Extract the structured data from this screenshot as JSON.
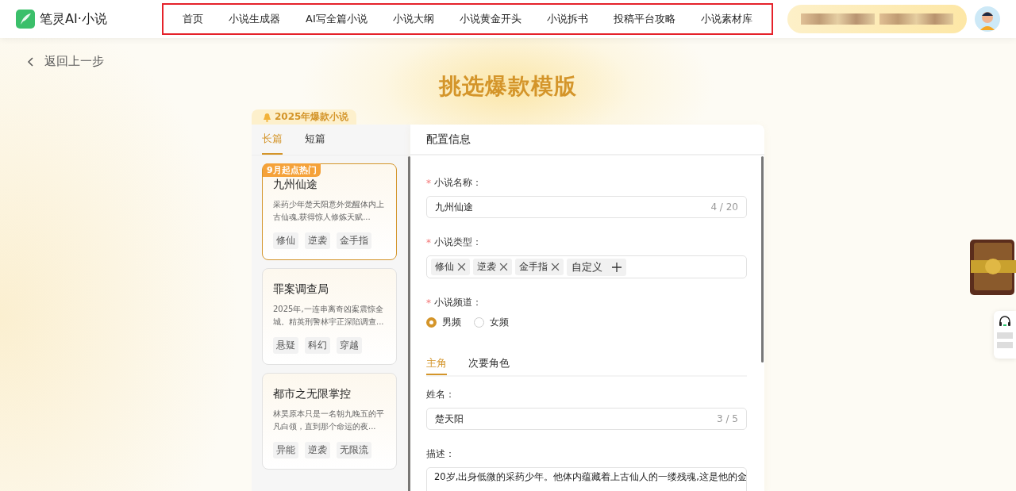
{
  "header": {
    "logo_text": "笔灵AI·小说",
    "nav": [
      {
        "label": "首页"
      },
      {
        "label": "小说生成器"
      },
      {
        "label": "AI写全篇小说"
      },
      {
        "label": "小说大纲"
      },
      {
        "label": "小说黄金开头"
      },
      {
        "label": "小说拆书"
      },
      {
        "label": "投稿平台攻略"
      },
      {
        "label": "小说素材库"
      }
    ]
  },
  "back_link": "返回上一步",
  "page_title": "挑选爆款模版",
  "section_badge": "2025年爆款小说",
  "length_tabs": [
    {
      "label": "长篇",
      "selected": true
    },
    {
      "label": "短篇",
      "selected": false
    }
  ],
  "templates": [
    {
      "title": "九州仙途",
      "summary": "采药少年楚天阳意外觉醒体内上古仙魂,获得惊人修炼天赋...",
      "tags": [
        "修仙",
        "逆袭",
        "金手指"
      ],
      "selected": true,
      "ribbon": "9月起点热门"
    },
    {
      "title": "罪案调查局",
      "summary": "2025年,一连串离奇凶案震惊全城。精英刑警林宇正深陷调查...",
      "tags": [
        "悬疑",
        "科幻",
        "穿越"
      ],
      "selected": false
    },
    {
      "title": "都市之无限掌控",
      "summary": "林昊原本只是一名朝九晚五的平凡白领，直到那个命运的夜...",
      "tags": [
        "异能",
        "逆袭",
        "无限流"
      ],
      "selected": false
    }
  ],
  "config": {
    "heading": "配置信息",
    "name_field": {
      "label": "小说名称：",
      "required_mark": "*",
      "value": "九州仙途",
      "counter": "4 / 20"
    },
    "genre_field": {
      "label": "小说类型：",
      "required_mark": "*",
      "tags": [
        "修仙",
        "逆袭",
        "金手指"
      ],
      "add_label": "自定义"
    },
    "channel_field": {
      "label": "小说频道：",
      "required_mark": "*",
      "options": [
        {
          "label": "男频",
          "selected": true
        },
        {
          "label": "女频",
          "selected": false
        }
      ]
    },
    "role_tabs": [
      {
        "label": "主角",
        "selected": true
      },
      {
        "label": "次要角色",
        "selected": false
      }
    ],
    "role_name": {
      "label": "姓名：",
      "value": "楚天阳",
      "counter": "3 / 5"
    },
    "role_desc": {
      "label": "描述：",
      "value": "20岁,出身低微的采药少年。他体内蕴藏着上古仙人的一缕残魂,这是他的金"
    }
  }
}
